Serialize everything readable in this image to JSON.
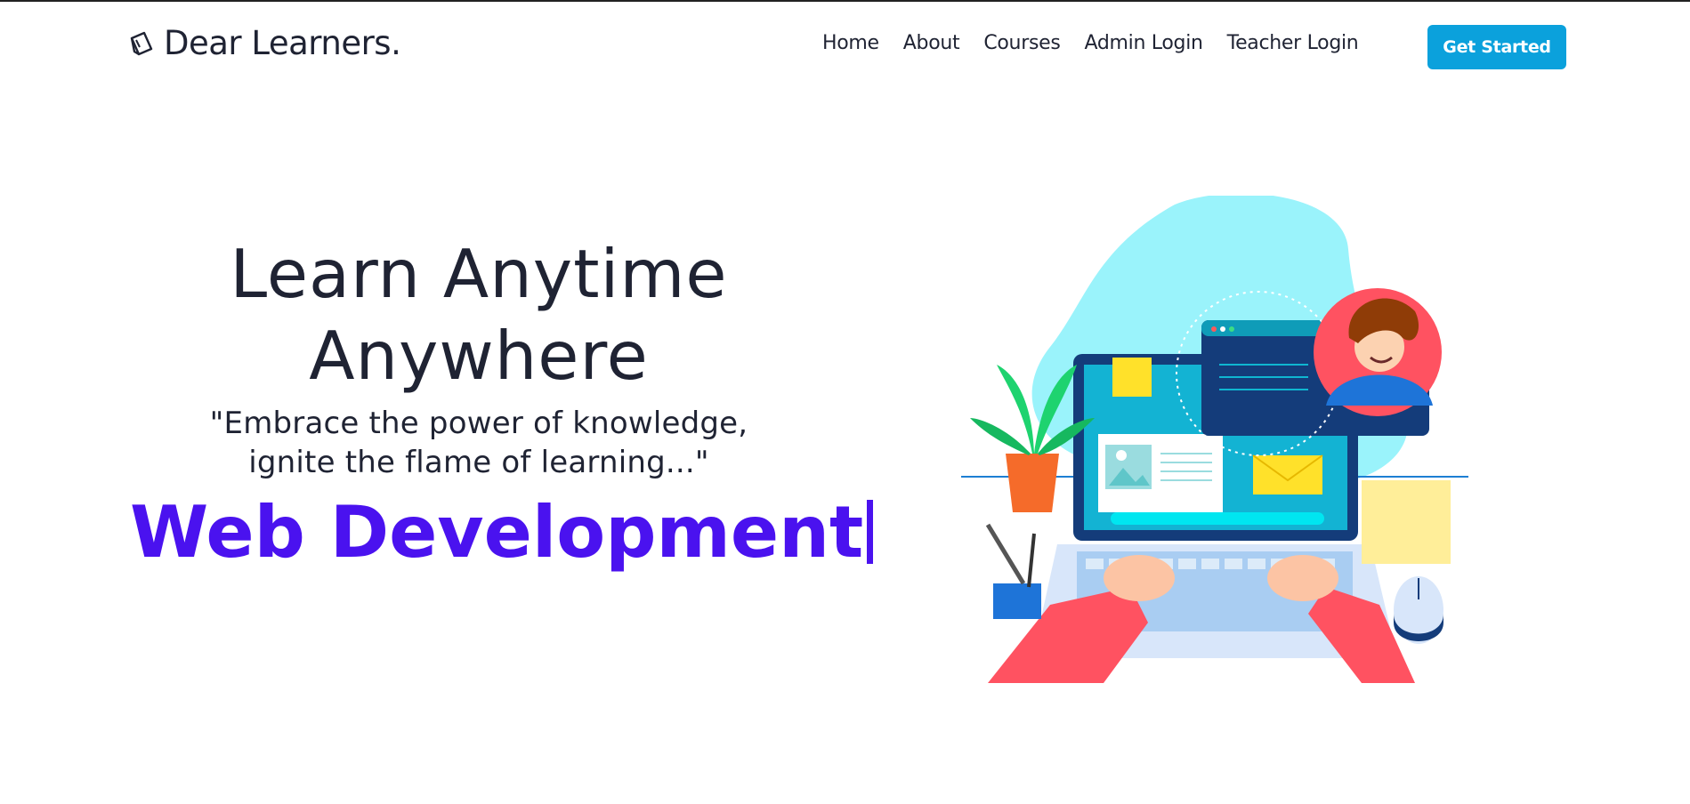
{
  "brand": {
    "name": "Dear Learners.",
    "icon": "book-icon"
  },
  "nav": {
    "items": [
      {
        "label": "Home"
      },
      {
        "label": "About"
      },
      {
        "label": "Courses"
      },
      {
        "label": "Admin Login"
      },
      {
        "label": "Teacher Login"
      }
    ],
    "cta_label": "Get Started"
  },
  "hero": {
    "title_line1": "Learn Anytime",
    "title_line2": "Anywhere",
    "quote_line1": "\"Embrace the power of knowledge,",
    "quote_line2": "ignite the flame of learning...\"",
    "typed_text": "Web Development"
  },
  "colors": {
    "accent": "#0ba1dc",
    "typed": "#4a12ef",
    "text": "#1f2333"
  },
  "illustration": {
    "icon": "online-learning-illustration"
  }
}
